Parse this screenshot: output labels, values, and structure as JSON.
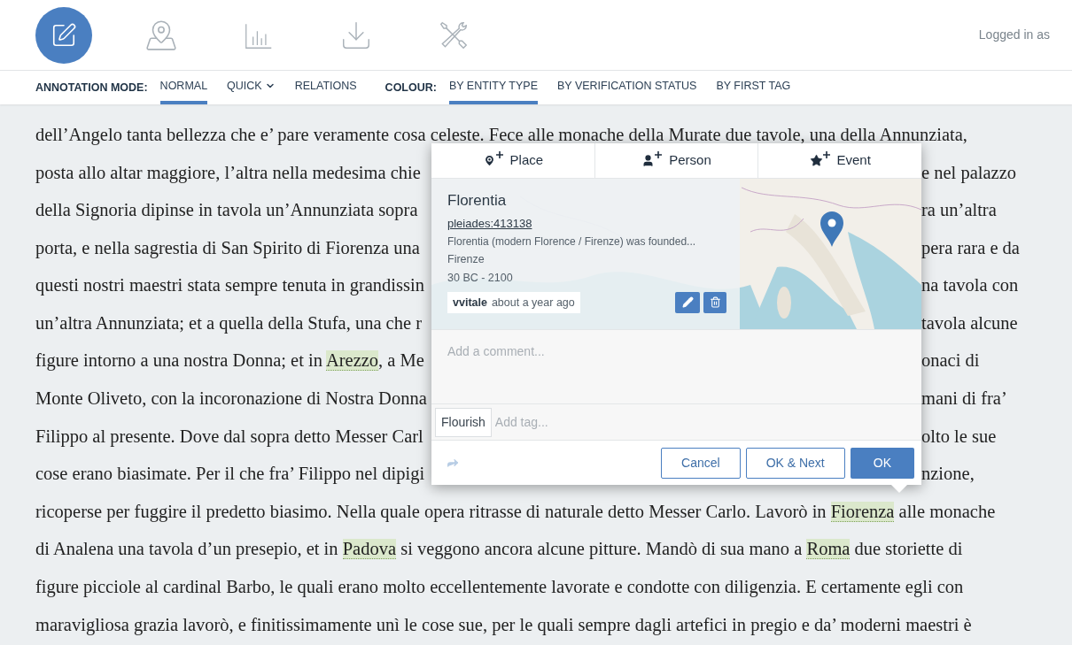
{
  "toolbar": {
    "tools": [
      {
        "kind": "annotate",
        "selected": true
      },
      {
        "kind": "map",
        "selected": false
      },
      {
        "kind": "chart",
        "selected": false
      },
      {
        "kind": "download",
        "selected": false
      },
      {
        "kind": "tools",
        "selected": false
      }
    ],
    "user_label": "Logged in as"
  },
  "mode_bar": {
    "groups": [
      {
        "label": "ANNOTATION MODE:",
        "options": [
          {
            "label": "NORMAL",
            "selected": true,
            "dropdown": false
          },
          {
            "label": "QUICK",
            "selected": false,
            "dropdown": true
          },
          {
            "label": "RELATIONS",
            "selected": false,
            "dropdown": false
          }
        ]
      },
      {
        "label": "COLOUR:",
        "options": [
          {
            "label": "BY ENTITY TYPE",
            "selected": true,
            "dropdown": false
          },
          {
            "label": "BY VERIFICATION STATUS",
            "selected": false,
            "dropdown": false
          },
          {
            "label": "BY FIRST TAG",
            "selected": false,
            "dropdown": false
          }
        ]
      }
    ]
  },
  "text_lines": [
    {
      "left": [
        {
          "kind": "plain",
          "text": "dell’Angelo tanta bellezza che e’ pare veramente cosa celeste. Fece alle monache della Murate due tavole, una della Annunziata,"
        }
      ]
    },
    {
      "left": [
        {
          "kind": "plain",
          "text": "posta allo altar maggiore, l’altra nella medesima chie"
        }
      ],
      "right": [
        {
          "kind": "plain",
          "text": "e nel palazzo"
        }
      ]
    },
    {
      "left": [
        {
          "kind": "plain",
          "text": "della Signoria dipinse in tavola un’Annunziata sopra"
        }
      ],
      "right": [
        {
          "kind": "plain",
          "text": "ra un’altra"
        }
      ]
    },
    {
      "left": [
        {
          "kind": "plain",
          "text": "porta, e nella sagrestia di San Spirito di Fiorenza una"
        }
      ],
      "right": [
        {
          "kind": "plain",
          "text": "pera rara e da"
        }
      ]
    },
    {
      "left": [
        {
          "kind": "plain",
          "text": "questi nostri maestri stata sempre tenuta in grandissin"
        }
      ],
      "right": [
        {
          "kind": "plain",
          "text": "na tavola con"
        }
      ]
    },
    {
      "left": [
        {
          "kind": "plain",
          "text": "un’altra Annunziata; et a quella della Stufa, una che r"
        }
      ],
      "right": [
        {
          "kind": "plain",
          "text": "tavola alcune"
        }
      ]
    },
    {
      "left": [
        {
          "kind": "plain",
          "text": "figure intorno a una nostra Donna; et in "
        },
        {
          "kind": "entity",
          "text": "Arezzo"
        },
        {
          "kind": "plain",
          "text": ", a Me"
        }
      ],
      "right": [
        {
          "kind": "plain",
          "text": "onaci di"
        }
      ]
    },
    {
      "left": [
        {
          "kind": "plain",
          "text": "Monte Oliveto, con la incoronazione di Nostra Donna"
        }
      ],
      "right": [
        {
          "kind": "plain",
          "text": "mani di fra’"
        }
      ]
    },
    {
      "left": [
        {
          "kind": "plain",
          "text": "Filippo al presente. Dove dal sopra detto Messer Carl"
        }
      ],
      "right": [
        {
          "kind": "plain",
          "text": "olto le sue"
        }
      ]
    },
    {
      "left": [
        {
          "kind": "plain",
          "text": "cose erano biasimate. Per il che fra’ Filippo nel dipigi"
        }
      ],
      "right": [
        {
          "kind": "plain",
          "text": "nzione,"
        }
      ]
    },
    {
      "left": [
        {
          "kind": "plain",
          "text": "ricoperse per fuggire il predetto biasimo. Nella quale opera ritrasse di naturale detto Messer Carlo. Lavorò in "
        },
        {
          "kind": "entity",
          "text": "Fiorenza"
        },
        {
          "kind": "plain",
          "text": " alle monache"
        }
      ]
    },
    {
      "left": [
        {
          "kind": "plain",
          "text": "di Analena una tavola d’un presepio, et in "
        },
        {
          "kind": "entity",
          "text": "Padova"
        },
        {
          "kind": "plain",
          "text": " si veggono ancora alcune pitture. Mandò di sua mano a "
        },
        {
          "kind": "entity",
          "text": "Roma"
        },
        {
          "kind": "plain",
          "text": " due storiette di"
        }
      ]
    },
    {
      "left": [
        {
          "kind": "plain",
          "text": "figure picciole al cardinal Barbo, le quali erano molto eccellentemente lavorate e condotte con diligenzia. E certamente egli con"
        }
      ]
    },
    {
      "left": [
        {
          "kind": "plain",
          "text": "maravigliosa grazia lavorò, e finitissimamente unì le cose sue, per le quali sempre dagli artefici in pregio e da’ moderni maestri è"
        }
      ]
    }
  ],
  "popup": {
    "tabs": [
      {
        "kind": "place",
        "label": "Place"
      },
      {
        "kind": "person",
        "label": "Person"
      },
      {
        "kind": "event",
        "label": "Event"
      }
    ],
    "entity": {
      "title": "Florentia",
      "uri": "pleiades:413138",
      "description": "Florentia (modern Florence / Firenze) was founded...",
      "alt_name": "Firenze",
      "date_range": "30 BC - 2100",
      "author": "vvitale",
      "time": "about a year ago"
    },
    "comment": {
      "placeholder": "Add a comment..."
    },
    "tags": [
      {
        "label": "Flourish"
      }
    ],
    "tag_input": {
      "placeholder": "Add tag..."
    },
    "buttons": [
      {
        "kind": "secondary",
        "label": "Cancel"
      },
      {
        "kind": "secondary",
        "label": "OK & Next"
      },
      {
        "kind": "primary",
        "label": "OK"
      }
    ]
  }
}
